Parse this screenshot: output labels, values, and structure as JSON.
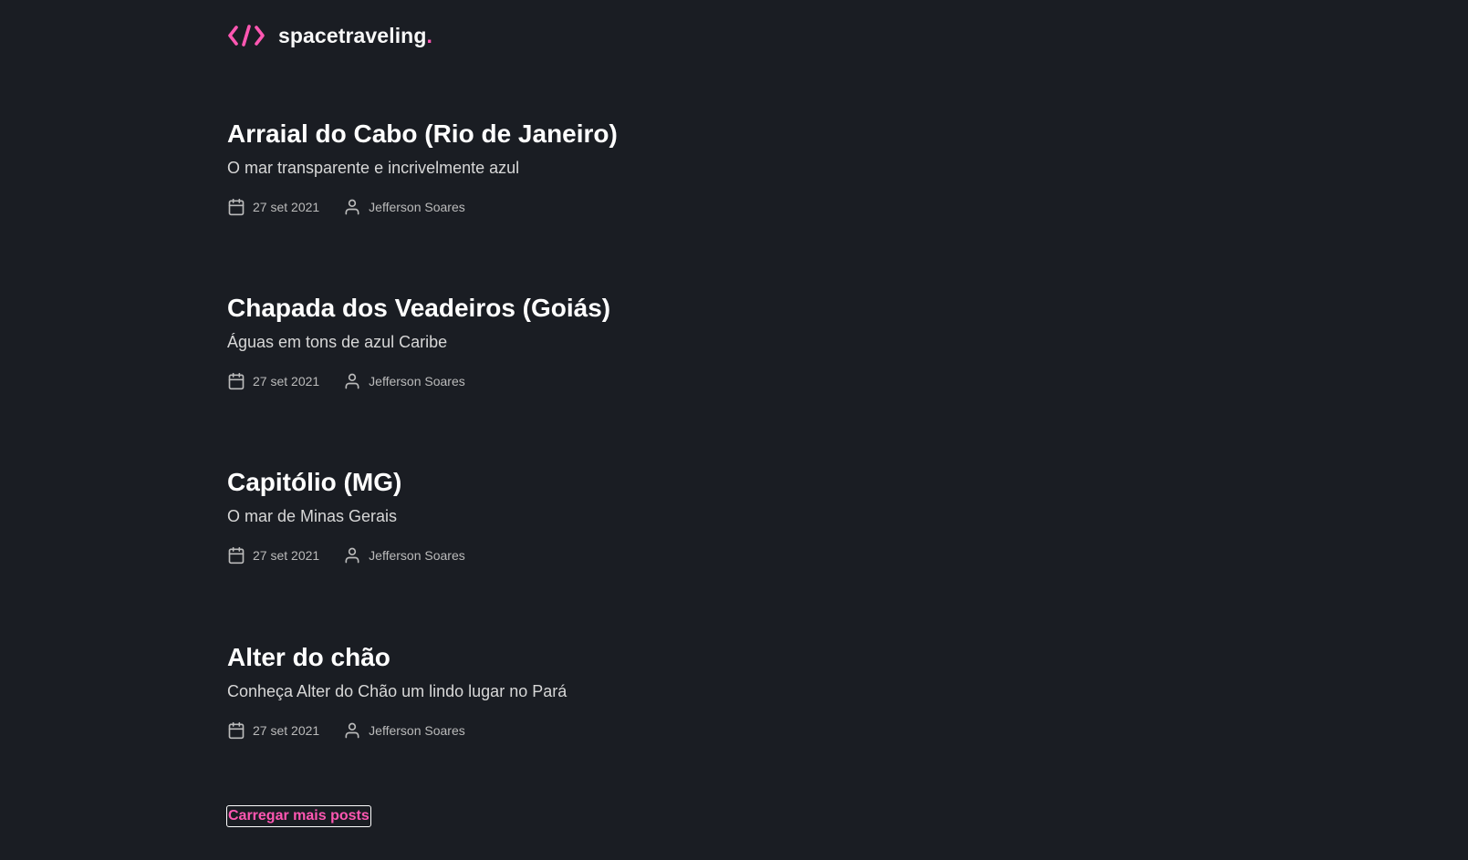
{
  "header": {
    "brand": "spacetraveling",
    "brand_dot": ".",
    "logo_icon": "code-brackets-icon",
    "accent_color": "#ff57b2"
  },
  "posts": [
    {
      "title": "Arraial do Cabo (Rio de Janeiro)",
      "subtitle": "O mar transparente e incrivelmente azul",
      "date": "27 set 2021",
      "author": "Jefferson Soares"
    },
    {
      "title": "Chapada dos Veadeiros (Goiás)",
      "subtitle": "Águas em tons de azul Caribe",
      "date": "27 set 2021",
      "author": "Jefferson Soares"
    },
    {
      "title": "Capitólio (MG)",
      "subtitle": "O mar de Minas Gerais",
      "date": "27 set 2021",
      "author": "Jefferson Soares"
    },
    {
      "title": "Alter do chão",
      "subtitle": "Conheça Alter do Chão um lindo lugar no Pará",
      "date": "27 set 2021",
      "author": "Jefferson Soares"
    }
  ],
  "load_more_label": "Carregar mais posts",
  "icons": {
    "date": "calendar-icon",
    "author": "user-icon"
  },
  "colors": {
    "background": "#1a1d23",
    "title": "#ffffff",
    "subtitle": "#d7d7d7",
    "meta": "#bbbbbb",
    "accent": "#ff57b2"
  }
}
